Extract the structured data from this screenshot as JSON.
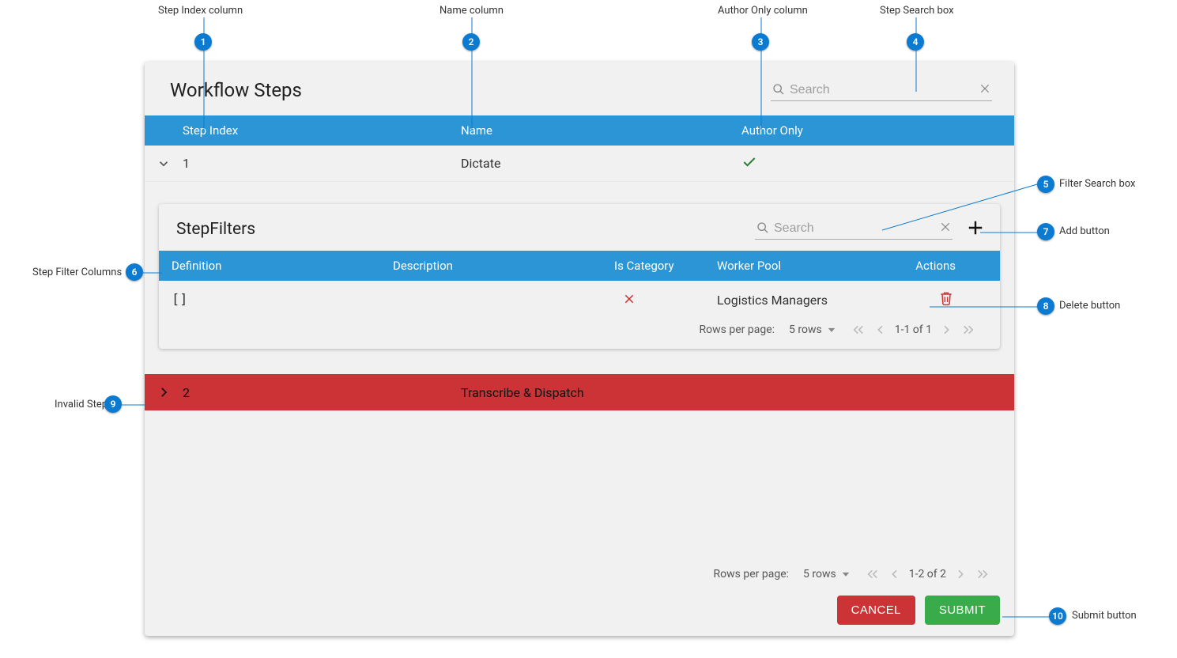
{
  "panel": {
    "title": "Workflow Steps",
    "search_placeholder": "Search"
  },
  "columns": {
    "step_index": "Step Index",
    "name": "Name",
    "author_only": "Author Only"
  },
  "step1": {
    "index": "1",
    "name": "Dictate"
  },
  "filters_panel": {
    "title": "StepFilters",
    "search_placeholder": "Search"
  },
  "filter_columns": {
    "definition": "Definition",
    "description": "Description",
    "is_category": "Is Category",
    "worker_pool": "Worker Pool",
    "actions": "Actions"
  },
  "filter_row": {
    "definition": "[]",
    "description": "",
    "worker_pool": "Logistics Managers"
  },
  "pagination_inner": {
    "rows_label": "Rows per page:",
    "rows_value": "5 rows",
    "range": "1-1 of 1"
  },
  "step2": {
    "index": "2",
    "name": "Transcribe & Dispatch"
  },
  "pagination_outer": {
    "rows_label": "Rows per page:",
    "rows_value": "5 rows",
    "range": "1-2 of 2"
  },
  "buttons": {
    "cancel": "CANCEL",
    "submit": "SUBMIT"
  },
  "callouts": {
    "c1": "Step Index column",
    "c2": "Name column",
    "c3": "Author Only column",
    "c4": "Step Search box",
    "c5": "Filter Search box",
    "c6": "Step Filter Columns",
    "c7": "Add button",
    "c8": "Delete button",
    "c9": "Invalid Step",
    "c10": "Submit button"
  }
}
